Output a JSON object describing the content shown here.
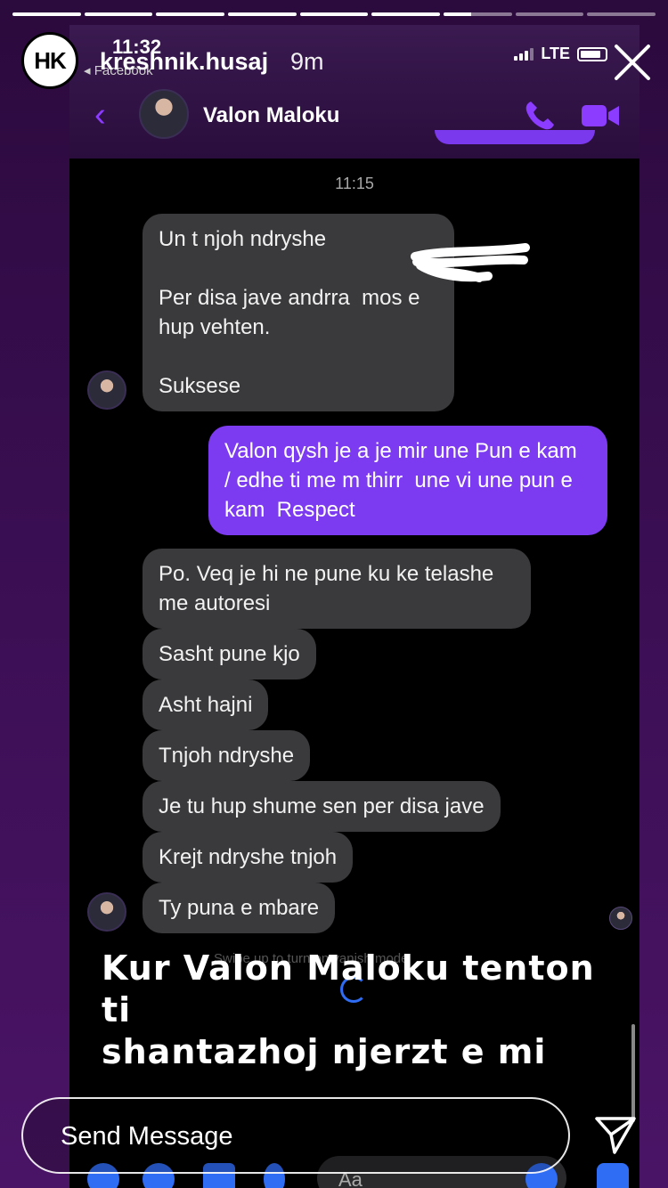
{
  "story": {
    "username": "kreshnik.husaj",
    "age": "9m",
    "logo_text": "HK",
    "segments": [
      1,
      1,
      1,
      1,
      1,
      1,
      0.4,
      0,
      0
    ]
  },
  "phone": {
    "status_time": "11:32",
    "status_back": "◂ Facebook",
    "network": "LTE"
  },
  "chat": {
    "contact_name": "Valon Maloku",
    "timestamp": "11:15",
    "messages": [
      {
        "from": "them",
        "text": "Un t njoh ndryshe\n\nPer disa jave andrra  mos e hup vehten.\n\nSuksese"
      },
      {
        "from": "me",
        "text": "Valon qysh je a je mir une Pun e kam  / edhe ti me m thirr  une vi une pun e kam  Respect"
      },
      {
        "from": "them",
        "text": "Po. Veq je hi ne pune ku ke telashe me autoresi"
      },
      {
        "from": "them",
        "text": "Sasht pune kjo"
      },
      {
        "from": "them",
        "text": "Asht hajni"
      },
      {
        "from": "them",
        "text": "Tnjoh ndryshe"
      },
      {
        "from": "them",
        "text": "Je tu hup shume sen per disa jave"
      },
      {
        "from": "them",
        "text": "Krejt ndryshe tnjoh"
      },
      {
        "from": "them",
        "text": "Ty puna e mbare"
      }
    ],
    "faded_hint": "Swipe up to turn on vanish mode",
    "composer_placeholder": "Aa"
  },
  "overlay_caption": "Kur Valon Maloku tenton ti\nshantazhoj njerzt e mi",
  "reply": {
    "placeholder": "Send Message"
  }
}
